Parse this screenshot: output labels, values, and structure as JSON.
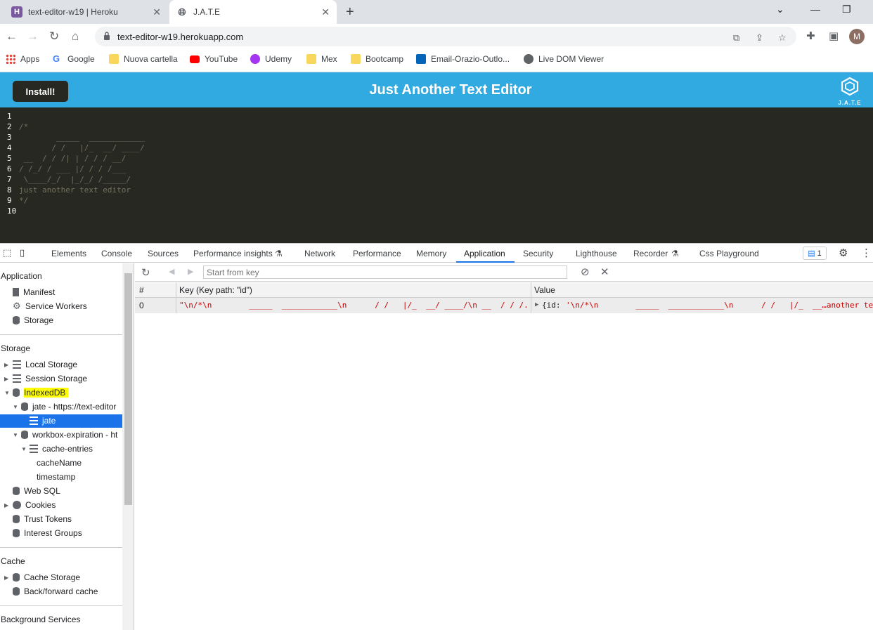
{
  "browser": {
    "tabs": [
      {
        "title": "text-editor-w19 | Heroku",
        "favicon": "heroku-icon"
      },
      {
        "title": "J.A.T.E",
        "favicon": "globe-icon"
      }
    ],
    "url": "text-editor-w19.herokuapp.com",
    "avatar_letter": "M",
    "bookmarks": [
      {
        "label": "Apps",
        "icon": "apps-grid-icon"
      },
      {
        "label": "Google",
        "icon": "google-icon"
      },
      {
        "label": "Nuova cartella",
        "icon": "folder-icon"
      },
      {
        "label": "YouTube",
        "icon": "youtube-icon"
      },
      {
        "label": "Udemy",
        "icon": "udemy-icon"
      },
      {
        "label": "Mex",
        "icon": "folder-icon"
      },
      {
        "label": "Bootcamp",
        "icon": "folder-icon"
      },
      {
        "label": "Email-Orazio-Outlo...",
        "icon": "outlook-icon"
      },
      {
        "label": "Live DOM Viewer",
        "icon": "globe-icon"
      }
    ]
  },
  "app": {
    "install_label": "Install!",
    "title": "Just Another Text Editor",
    "logo_text": "J.A.T.E",
    "editor_lines": [
      {
        "n": "1",
        "text": ""
      },
      {
        "n": "2",
        "text": "/*"
      },
      {
        "n": "3",
        "text": "        _____  ____________"
      },
      {
        "n": "4",
        "text": "       / /   |/_  __/ ____/"
      },
      {
        "n": "5",
        "text": " __  / / /| | / / / __/"
      },
      {
        "n": "6",
        "text": "/ /_/ / ___ |/ / / /___"
      },
      {
        "n": "7",
        "text": " \\____/_/  |_/_/ /_____/"
      },
      {
        "n": "8",
        "text": "just another text editor"
      },
      {
        "n": "9",
        "text": "*/"
      },
      {
        "n": "10",
        "text": ""
      }
    ]
  },
  "devtools": {
    "tabs": [
      "Elements",
      "Console",
      "Sources",
      "Performance insights",
      "Network",
      "Performance",
      "Memory",
      "Application",
      "Security",
      "Lighthouse",
      "Recorder",
      "Css Playground"
    ],
    "active_tab": "Application",
    "issues_count": "1",
    "sidebar": {
      "application_header": "Application",
      "application_items": [
        "Manifest",
        "Service Workers",
        "Storage"
      ],
      "storage_header": "Storage",
      "local_storage": "Local Storage",
      "session_storage": "Session Storage",
      "indexeddb": "IndexedDB",
      "db_jate": "jate - https://text-editor",
      "store_jate": "jate",
      "db_workbox": "workbox-expiration - ht",
      "store_cache": "cache-entries",
      "index_cachename": "cacheName",
      "index_timestamp": "timestamp",
      "web_sql": "Web SQL",
      "cookies": "Cookies",
      "trust_tokens": "Trust Tokens",
      "interest_groups": "Interest Groups",
      "cache_header": "Cache",
      "cache_storage": "Cache Storage",
      "bfcache": "Back/forward cache",
      "background_header": "Background Services"
    },
    "key_placeholder": "Start from key",
    "table": {
      "col_num": "#",
      "col_key": "Key (Key path: \"id\")",
      "col_value": "Value",
      "rows": [
        {
          "num": "0",
          "key": "\"\\n/*\\n        _____  ____________\\n      / /   |/_  __/ ____/\\n __  / / /...",
          "value_prefix": "{id: ",
          "value": "'\\n/*\\n        _____  ____________\\n      / /   |/_  __…another text"
        }
      ]
    }
  }
}
